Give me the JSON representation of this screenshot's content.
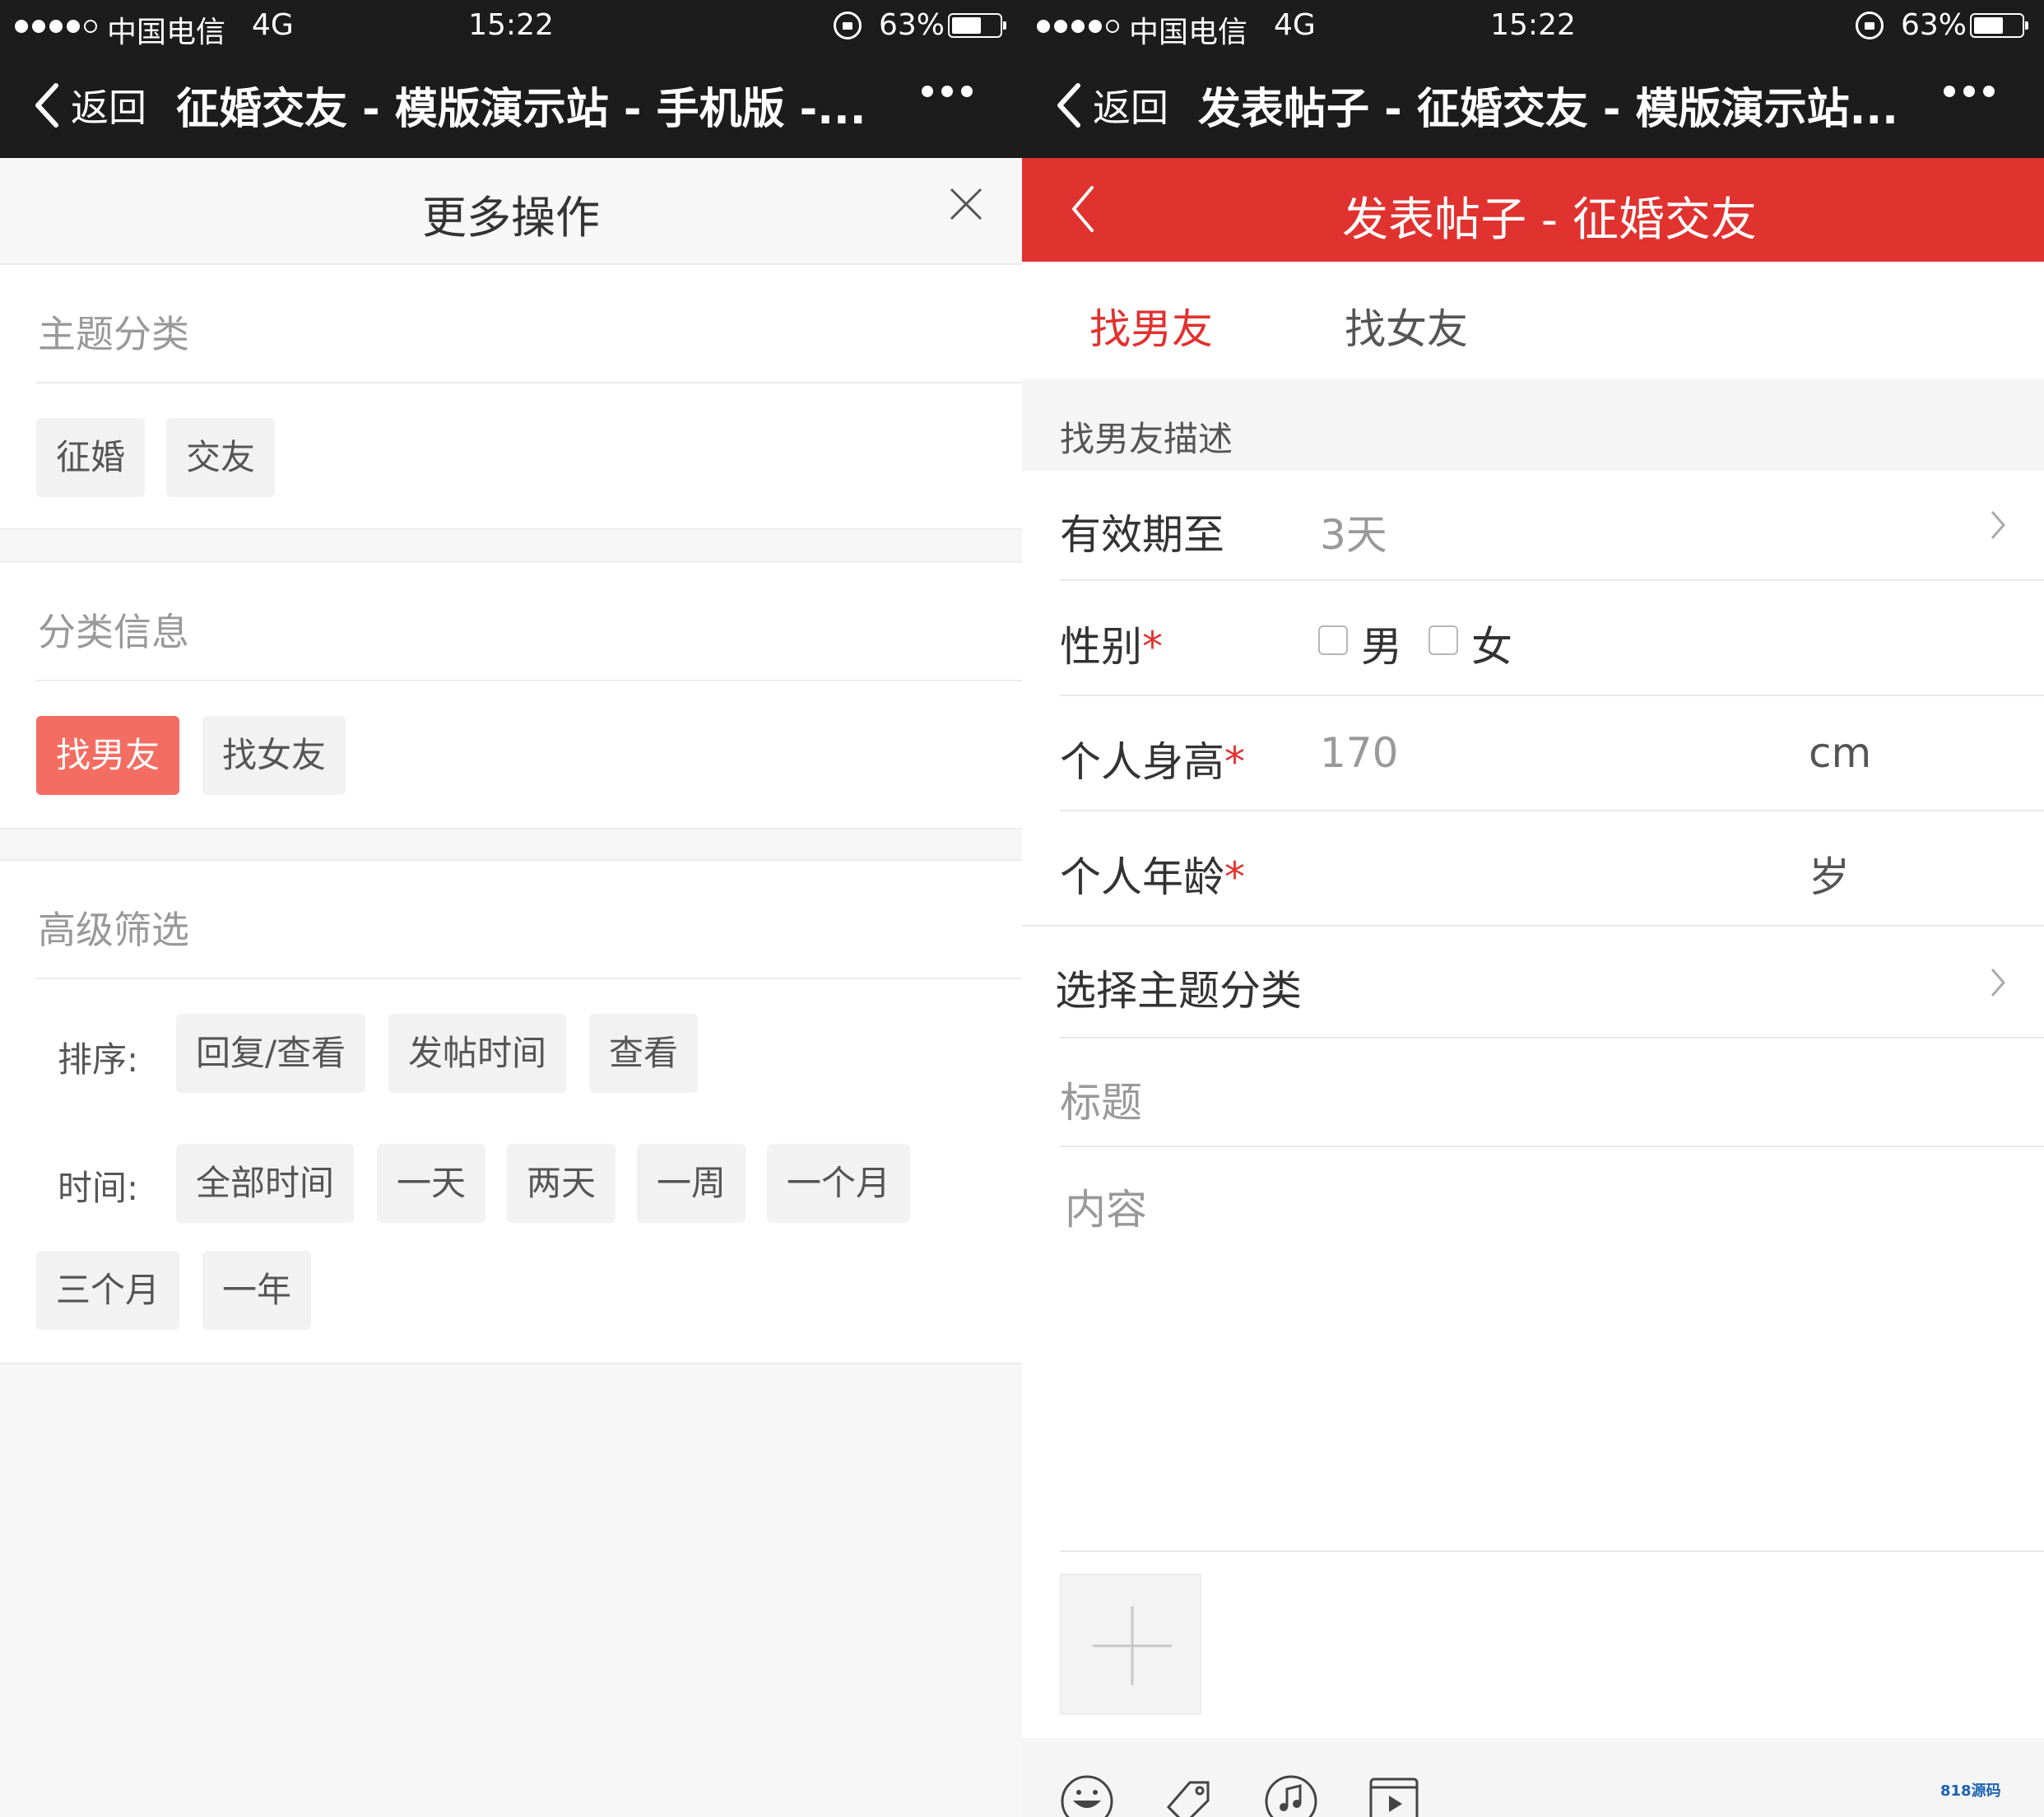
{
  "status": {
    "carrier": "中国电信",
    "network": "4G",
    "time": "15:22",
    "battery": "63%",
    "battery_level": 0.63
  },
  "left": {
    "nav": {
      "back_label": "返回",
      "title": "征婚交友 - 模版演示站 - 手机版 -..."
    },
    "sheet_title": "更多操作",
    "section1": {
      "header": "主题分类",
      "chips": [
        "征婚",
        "交友"
      ]
    },
    "section2": {
      "header": "分类信息",
      "chips": [
        "找男友",
        "找女友"
      ],
      "active": "找男友"
    },
    "section3": {
      "header": "高级筛选",
      "sort_label": "排序:",
      "sort_chips": [
        "回复/查看",
        "发帖时间",
        "查看"
      ],
      "time_label": "时间:",
      "time_chips": [
        "全部时间",
        "一天",
        "两天",
        "一周",
        "一个月",
        "三个月",
        "一年"
      ]
    }
  },
  "right": {
    "nav": {
      "back_label": "返回",
      "title": "发表帖子 - 征婚交友 - 模版演示站..."
    },
    "header_title": "发表帖子 - 征婚交友",
    "tabs": [
      "找男友",
      "找女友"
    ],
    "active_tab": "找男友",
    "description": "找男友描述",
    "form": {
      "expiry_label": "有效期至",
      "expiry_value": "3天",
      "gender_label": "性别",
      "gender_options": [
        "男",
        "女"
      ],
      "height_label": "个人身高",
      "height_placeholder": "170",
      "height_unit": "cm",
      "age_label": "个人年龄",
      "age_unit": "岁",
      "required_mark": "*",
      "category_label": "选择主题分类",
      "title_placeholder": "标题",
      "content_placeholder": "内容"
    },
    "toolbar_icons": [
      "emoji-icon",
      "tag-icon",
      "music-icon",
      "video-icon"
    ],
    "watermark": "818源码"
  },
  "colors": {
    "accent_red": "#e0322f",
    "chip_active": "#f46d62",
    "nav_dark": "#1c1c1c"
  }
}
